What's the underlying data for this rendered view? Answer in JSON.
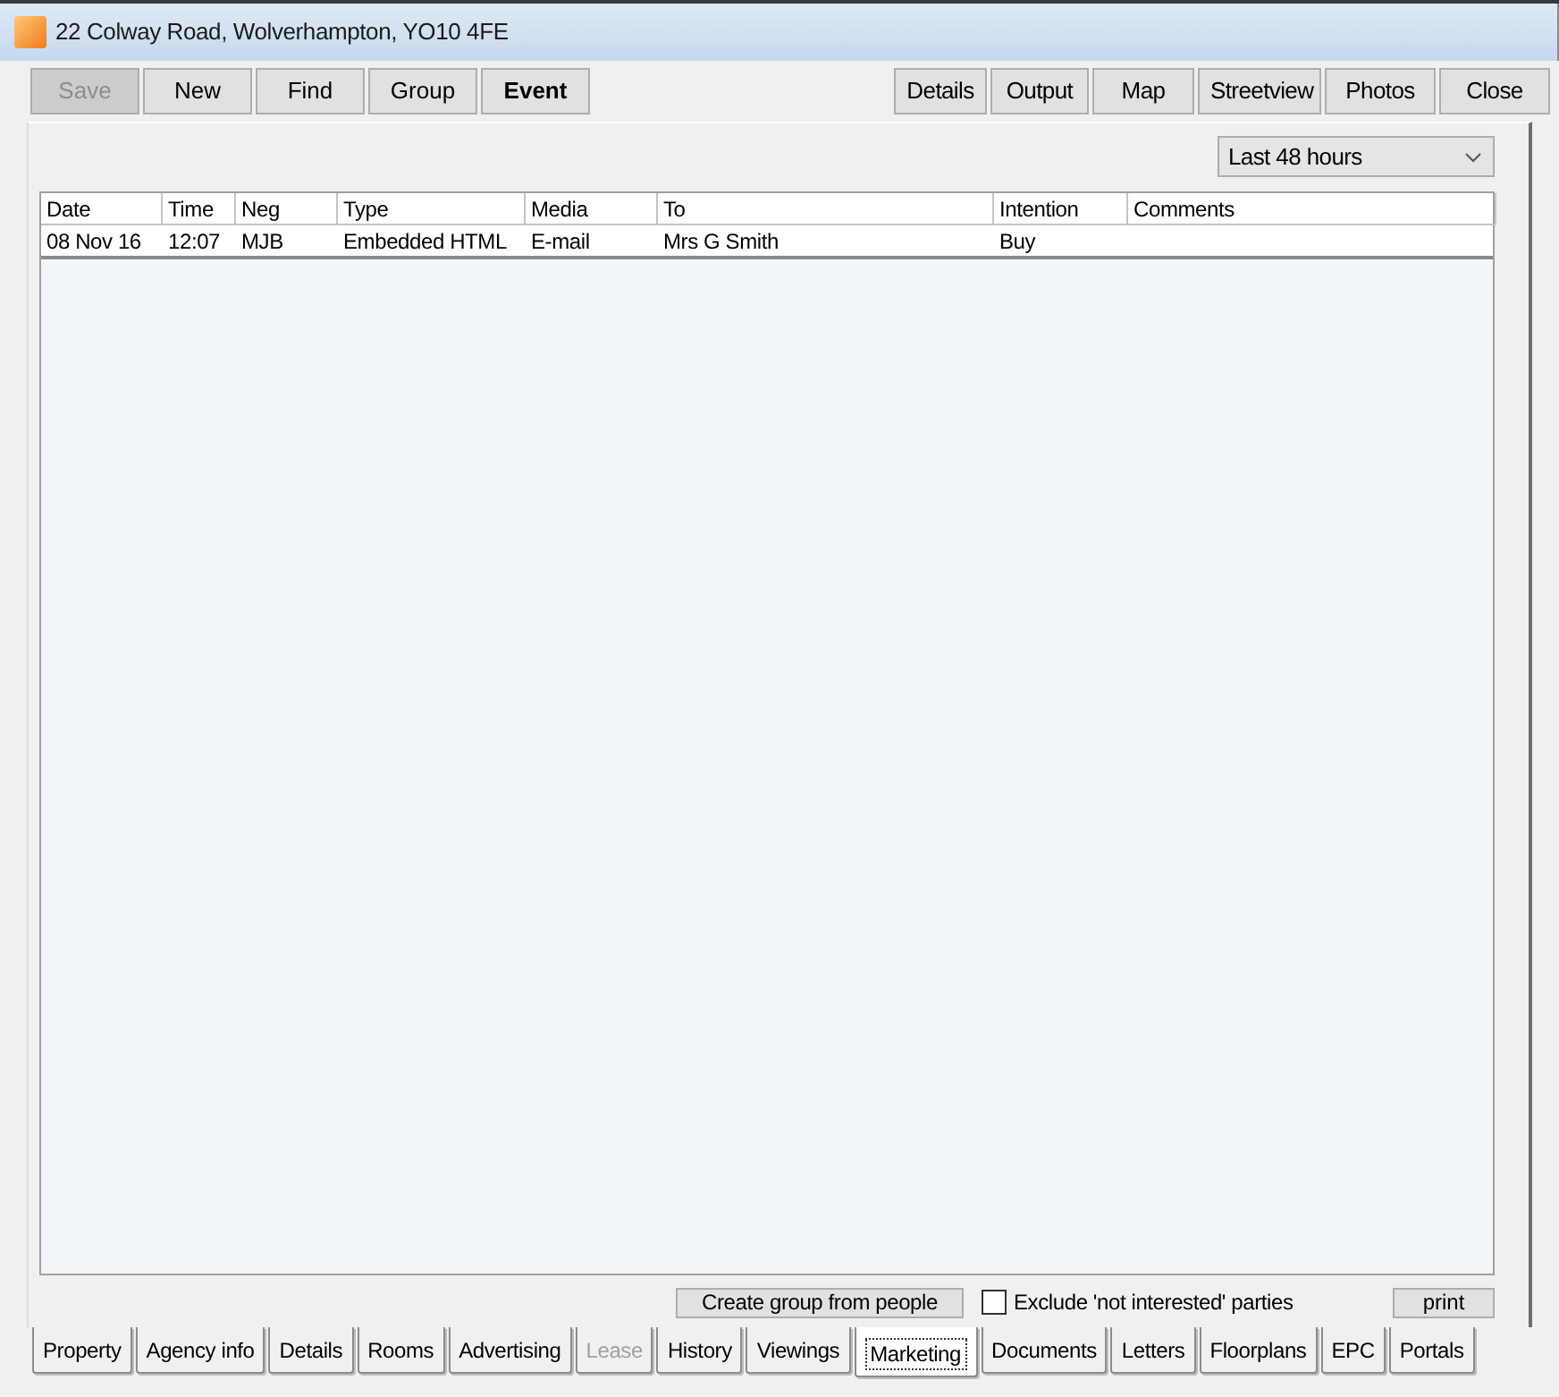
{
  "window": {
    "title": "22 Colway Road, Wolverhampton, YO10 4FE"
  },
  "toolbar": {
    "left_buttons": [
      {
        "label": "Save",
        "disabled": true,
        "emphasized": false
      },
      {
        "label": "New",
        "disabled": false,
        "emphasized": false
      },
      {
        "label": "Find",
        "disabled": false,
        "emphasized": false
      },
      {
        "label": "Group",
        "disabled": false,
        "emphasized": false
      },
      {
        "label": "Event",
        "disabled": false,
        "emphasized": true
      }
    ],
    "right_buttons": [
      {
        "label": "Details"
      },
      {
        "label": "Output"
      },
      {
        "label": "Map"
      },
      {
        "label": "Streetview"
      },
      {
        "label": "Photos"
      },
      {
        "label": "Close"
      }
    ]
  },
  "period_filter": {
    "value": "Last 48 hours"
  },
  "table": {
    "columns": [
      "Date",
      "Time",
      "Neg",
      "Type",
      "Media",
      "To",
      "Intention",
      "Comments"
    ],
    "rows": [
      {
        "cells": [
          "08 Nov 16",
          "12:07",
          "MJB",
          "Embedded HTML",
          "E-mail",
          "Mrs G Smith",
          "Buy",
          ""
        ]
      }
    ]
  },
  "footer": {
    "create_group_button": "Create group from people",
    "exclude_checkbox": {
      "label": "Exclude 'not interested' parties",
      "checked": false
    },
    "print_button": "print"
  },
  "tabs": [
    {
      "label": "Property",
      "selected": false,
      "disabled": false
    },
    {
      "label": "Agency info",
      "selected": false,
      "disabled": false
    },
    {
      "label": "Details",
      "selected": false,
      "disabled": false
    },
    {
      "label": "Rooms",
      "selected": false,
      "disabled": false
    },
    {
      "label": "Advertising",
      "selected": false,
      "disabled": false
    },
    {
      "label": "Lease",
      "selected": false,
      "disabled": true
    },
    {
      "label": "History",
      "selected": false,
      "disabled": false
    },
    {
      "label": "Viewings",
      "selected": false,
      "disabled": false
    },
    {
      "label": "Marketing",
      "selected": true,
      "disabled": false
    },
    {
      "label": "Documents",
      "selected": false,
      "disabled": false
    },
    {
      "label": "Letters",
      "selected": false,
      "disabled": false
    },
    {
      "label": "Floorplans",
      "selected": false,
      "disabled": false
    },
    {
      "label": "EPC",
      "selected": false,
      "disabled": false
    },
    {
      "label": "Portals",
      "selected": false,
      "disabled": false
    }
  ]
}
